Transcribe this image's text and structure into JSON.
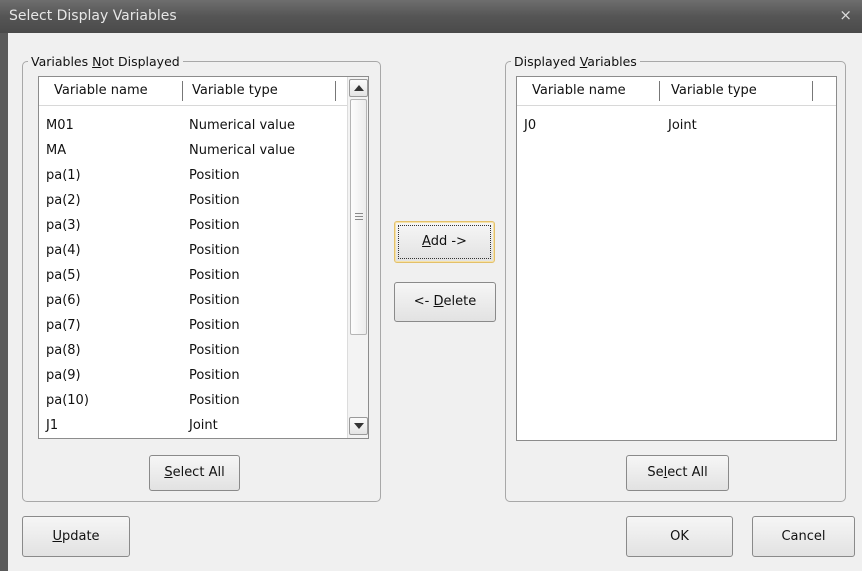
{
  "dialog": {
    "title": "Select Display Variables",
    "close_glyph": "×"
  },
  "left_panel": {
    "legend_pre": "Variables ",
    "legend_u": "N",
    "legend_post": "ot Displayed",
    "columns": [
      "Variable name",
      "Variable type"
    ],
    "rows": [
      {
        "name": "M01",
        "type": "Numerical value"
      },
      {
        "name": "MA",
        "type": "Numerical value"
      },
      {
        "name": "pa(1)",
        "type": "Position"
      },
      {
        "name": "pa(2)",
        "type": "Position"
      },
      {
        "name": "pa(3)",
        "type": "Position"
      },
      {
        "name": "pa(4)",
        "type": "Position"
      },
      {
        "name": "pa(5)",
        "type": "Position"
      },
      {
        "name": "pa(6)",
        "type": "Position"
      },
      {
        "name": "pa(7)",
        "type": "Position"
      },
      {
        "name": "pa(8)",
        "type": "Position"
      },
      {
        "name": "pa(9)",
        "type": "Position"
      },
      {
        "name": "pa(10)",
        "type": "Position"
      },
      {
        "name": "J1",
        "type": "Joint"
      }
    ],
    "select_all_u": "S",
    "select_all_post": "elect All"
  },
  "right_panel": {
    "legend_pre": "Displayed ",
    "legend_u": "V",
    "legend_post": "ariables",
    "columns": [
      "Variable name",
      "Variable type"
    ],
    "rows": [
      {
        "name": "J0",
        "type": "Joint"
      }
    ],
    "select_all_pre": "Se",
    "select_all_u": "l",
    "select_all_post": "ect All"
  },
  "middle": {
    "add_u": "A",
    "add_post": "dd ->",
    "delete_pre": "<- ",
    "delete_u": "D",
    "delete_post": "elete"
  },
  "footer": {
    "update_u": "U",
    "update_post": "pdate",
    "ok_label": "OK",
    "cancel_label": "Cancel"
  }
}
